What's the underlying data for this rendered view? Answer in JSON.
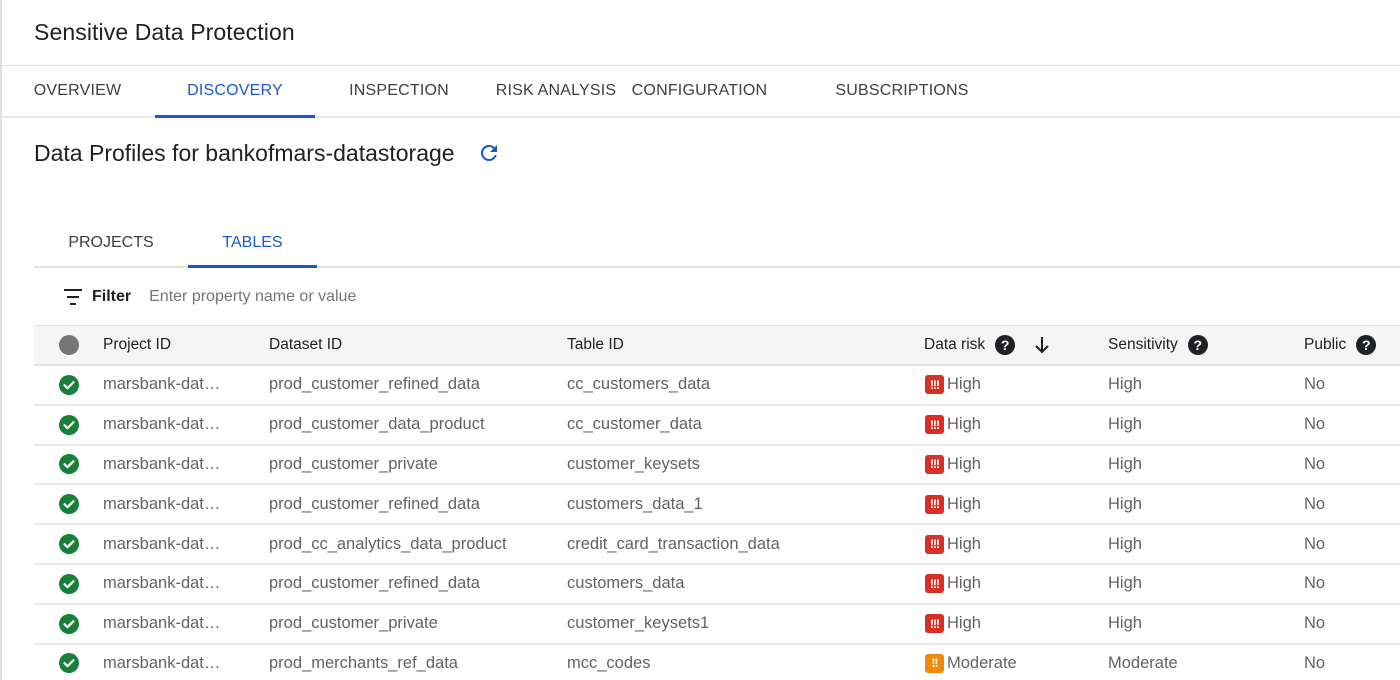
{
  "app": {
    "title": "Sensitive Data Protection"
  },
  "main_tabs": [
    {
      "label": "OVERVIEW",
      "active": false
    },
    {
      "label": "DISCOVERY",
      "active": true
    },
    {
      "label": "INSPECTION",
      "active": false
    },
    {
      "label": "RISK ANALYSIS",
      "active": false
    },
    {
      "label": "CONFIGURATION",
      "active": false
    },
    {
      "label": "SUBSCRIPTIONS",
      "active": false
    }
  ],
  "page": {
    "title": "Data Profiles for bankofmars-datastorage",
    "refresh_icon": "refresh-icon"
  },
  "sub_tabs": [
    {
      "label": "PROJECTS",
      "active": false
    },
    {
      "label": "TABLES",
      "active": true
    }
  ],
  "filter": {
    "label": "Filter",
    "placeholder": "Enter property name or value",
    "value": "",
    "icon": "filter-list-icon"
  },
  "colors": {
    "accent": "#1a57d0",
    "risk_high": "#d93025",
    "risk_moderate": "#ee8a0d",
    "status_ok": "#188038"
  },
  "table": {
    "columns": {
      "status": "",
      "project_id": "Project ID",
      "dataset_id": "Dataset ID",
      "table_id": "Table ID",
      "data_risk": "Data risk",
      "sensitivity": "Sensitivity",
      "public": "Public"
    },
    "sort": {
      "column": "data_risk",
      "direction": "descending"
    },
    "rows": [
      {
        "status": "check-circle-icon",
        "project_id": "marsbank-dat…",
        "dataset_id": "prod_customer_refined_data",
        "table_id": "cc_customers_data",
        "risk_badge": "!!!",
        "risk_level": "high",
        "data_risk": "High",
        "sensitivity": "High",
        "public": "No"
      },
      {
        "status": "check-circle-icon",
        "project_id": "marsbank-dat…",
        "dataset_id": "prod_customer_data_product",
        "table_id": "cc_customer_data",
        "risk_badge": "!!!",
        "risk_level": "high",
        "data_risk": "High",
        "sensitivity": "High",
        "public": "No"
      },
      {
        "status": "check-circle-icon",
        "project_id": "marsbank-dat…",
        "dataset_id": "prod_customer_private",
        "table_id": "customer_keysets",
        "risk_badge": "!!!",
        "risk_level": "high",
        "data_risk": "High",
        "sensitivity": "High",
        "public": "No"
      },
      {
        "status": "check-circle-icon",
        "project_id": "marsbank-dat…",
        "dataset_id": "prod_customer_refined_data",
        "table_id": "customers_data_1",
        "risk_badge": "!!!",
        "risk_level": "high",
        "data_risk": "High",
        "sensitivity": "High",
        "public": "No"
      },
      {
        "status": "check-circle-icon",
        "project_id": "marsbank-dat…",
        "dataset_id": "prod_cc_analytics_data_product",
        "table_id": "credit_card_transaction_data",
        "risk_badge": "!!!",
        "risk_level": "high",
        "data_risk": "High",
        "sensitivity": "High",
        "public": "No"
      },
      {
        "status": "check-circle-icon",
        "project_id": "marsbank-dat…",
        "dataset_id": "prod_customer_refined_data",
        "table_id": "customers_data",
        "risk_badge": "!!!",
        "risk_level": "high",
        "data_risk": "High",
        "sensitivity": "High",
        "public": "No"
      },
      {
        "status": "check-circle-icon",
        "project_id": "marsbank-dat…",
        "dataset_id": "prod_customer_private",
        "table_id": "customer_keysets1",
        "risk_badge": "!!!",
        "risk_level": "high",
        "data_risk": "High",
        "sensitivity": "High",
        "public": "No"
      },
      {
        "status": "check-circle-icon",
        "project_id": "marsbank-dat…",
        "dataset_id": "prod_merchants_ref_data",
        "table_id": "mcc_codes",
        "risk_badge": "!!",
        "risk_level": "moderate",
        "data_risk": "Moderate",
        "sensitivity": "Moderate",
        "public": "No"
      }
    ]
  }
}
